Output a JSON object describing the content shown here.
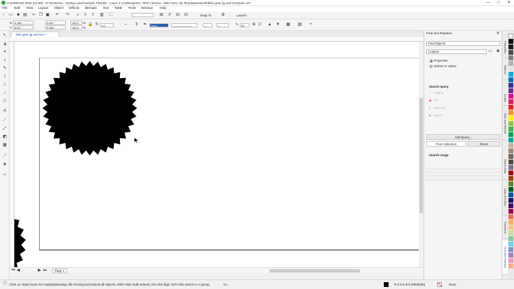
{
  "window": {
    "title": "CorelDRAW 2020 (64-Bit) - D:\\OneDrive - Epilog Laser\\Sample Files\\02 - Laser X Challenge\\04 - IRIS Camera - Bike Gear Jig Template\\artwork\\bike gear jig and template.cdr*",
    "minimize": "—",
    "maximize": "□",
    "close": "✕"
  },
  "menu": [
    "File",
    "Edit",
    "View",
    "Layout",
    "Object",
    "Effects",
    "Bitmaps",
    "Text",
    "Table",
    "Tools",
    "Window",
    "Help"
  ],
  "toolbar": {
    "snap_label": "Snap To",
    "launch_label": "Launch",
    "zoom_value": ""
  },
  "property_bar": {
    "x": "3.186 \"",
    "y": "8.817 \"",
    "width": "5.921 \"",
    "height": "5.906 \"",
    "scale_w": "100.0",
    "scale_h": "100.0",
    "percent": "%",
    "angle": "0.0",
    "outline": "None",
    "count": "50"
  },
  "tabs": [
    {
      "label": "bike gear jig and tem..*"
    }
  ],
  "page_tab": "Page 1",
  "docker": {
    "title": "Find and Replace",
    "find_mode": "Find Objects",
    "preset": "Custom",
    "options": [
      {
        "label": "Properties",
        "selected": true
      },
      {
        "label": "Names or Styles",
        "selected": false
      }
    ],
    "search_query_heading": "Search query",
    "query_items": [
      "Outline",
      "Fill",
      "Intersect",
      "Object"
    ],
    "add_query": "Add Query...",
    "from_selection": "From Selection",
    "reset": "Reset",
    "search_range_heading": "Search range",
    "range_button": "",
    "range_field": ""
  },
  "docker_tabs": [
    "Properties",
    "Objects",
    "Scripts",
    "Step and Repeat",
    "Object Data",
    "Align and Dist...",
    "Transform",
    "Find and Replace"
  ],
  "palette": [
    "#ffffff",
    "#000000",
    "#1a1a1a",
    "#4d4d4d",
    "#808080",
    "#b3b3b3",
    "#e6e6e6",
    "#00aeef",
    "#0072bc",
    "#2e3192",
    "#662d91",
    "#ec008c",
    "#ed145b",
    "#ed1c24",
    "#f7941d",
    "#fff200",
    "#8dc63f",
    "#39b54a",
    "#00a651",
    "#00a99d",
    "#c7b299",
    "#998675",
    "#736357",
    "#534741",
    "#7f6d8e",
    "#9e0b0f",
    "#a0410d",
    "#598527",
    "#005e20",
    "#0054a6",
    "#1b1464",
    "#440e62",
    "#9e005d",
    "#f26c4f",
    "#fbaf5d",
    "#fdc689",
    "#c4df9b",
    "#82ca9c",
    "#6dcff6",
    "#8393ca",
    "#a186be",
    "#f49ac2",
    "#f9ad81"
  ],
  "status": {
    "hint": "Click an object twice for rotating/skewing; dbl-clicking tool selects all objects; Shift+click multi-selects; Alt+click digs; Ctrl+click selects in a group",
    "unit": "Cu",
    "fill_info": "R:0 G:0 B:0 (#000000)",
    "outline_info": "None"
  },
  "colors": {
    "accent": "#1a4fa0",
    "shape": "#000000"
  }
}
